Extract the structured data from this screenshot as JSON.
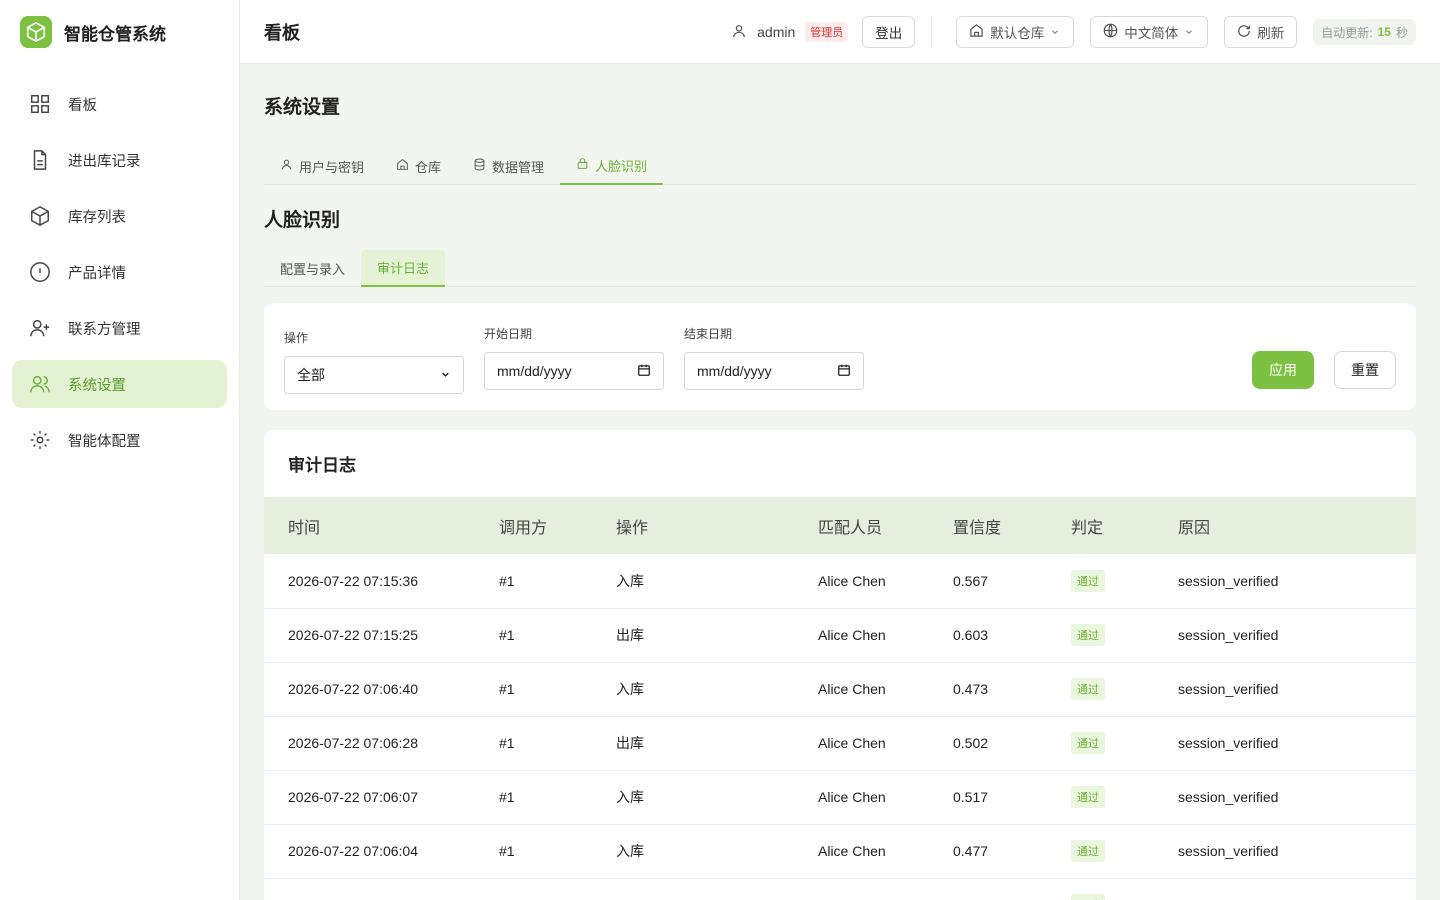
{
  "app": {
    "title": "智能仓管系统"
  },
  "sidebar": {
    "items": [
      {
        "label": "看板",
        "icon": "dashboard-icon"
      },
      {
        "label": "进出库记录",
        "icon": "document-icon"
      },
      {
        "label": "库存列表",
        "icon": "box-icon"
      },
      {
        "label": "产品详情",
        "icon": "info-icon"
      },
      {
        "label": "联系方管理",
        "icon": "user-plus-icon"
      },
      {
        "label": "系统设置",
        "icon": "users-icon",
        "active": true
      },
      {
        "label": "智能体配置",
        "icon": "sun-icon"
      }
    ]
  },
  "header": {
    "title": "看板",
    "user": "admin",
    "role": "管理员",
    "logout": "登出",
    "warehouse": "默认仓库",
    "language": "中文简体",
    "refresh": "刷新",
    "auto_update_label": "自动更新:",
    "auto_update_value": "15",
    "auto_update_unit": "秒"
  },
  "page": {
    "title": "系统设置",
    "tabs": [
      {
        "label": "用户与密钥",
        "icon": "user-icon"
      },
      {
        "label": "仓库",
        "icon": "home-icon"
      },
      {
        "label": "数据管理",
        "icon": "database-icon"
      },
      {
        "label": "人脸识别",
        "icon": "face-scan-icon",
        "active": true
      }
    ],
    "section_title": "人脸识别",
    "subtabs": [
      {
        "label": "配置与录入"
      },
      {
        "label": "审计日志",
        "active": true
      }
    ]
  },
  "filters": {
    "operation_label": "操作",
    "operation_value": "全部",
    "start_label": "开始日期",
    "start_placeholder": "mm/dd/yyyy",
    "end_label": "结束日期",
    "end_placeholder": "mm/dd/yyyy",
    "apply": "应用",
    "reset": "重置"
  },
  "log": {
    "title": "审计日志",
    "columns": [
      "时间",
      "调用方",
      "操作",
      "匹配人员",
      "置信度",
      "判定",
      "原因"
    ],
    "rows": [
      [
        "2026-07-22 07:15:36",
        "#1",
        "入库",
        "Alice Chen",
        "0.567",
        "通过",
        "session_verified"
      ],
      [
        "2026-07-22 07:15:25",
        "#1",
        "出库",
        "Alice Chen",
        "0.603",
        "通过",
        "session_verified"
      ],
      [
        "2026-07-22 07:06:40",
        "#1",
        "入库",
        "Alice Chen",
        "0.473",
        "通过",
        "session_verified"
      ],
      [
        "2026-07-22 07:06:28",
        "#1",
        "出库",
        "Alice Chen",
        "0.502",
        "通过",
        "session_verified"
      ],
      [
        "2026-07-22 07:06:07",
        "#1",
        "入库",
        "Alice Chen",
        "0.517",
        "通过",
        "session_verified"
      ],
      [
        "2026-07-22 07:06:04",
        "#1",
        "入库",
        "Alice Chen",
        "0.477",
        "通过",
        "session_verified"
      ],
      [
        "",
        "",
        "",
        "",
        "",
        "通过",
        ""
      ]
    ]
  },
  "colors": {
    "accent": "#7cc141",
    "active_bg": "#e4f2d4",
    "danger": "#dd3333"
  }
}
